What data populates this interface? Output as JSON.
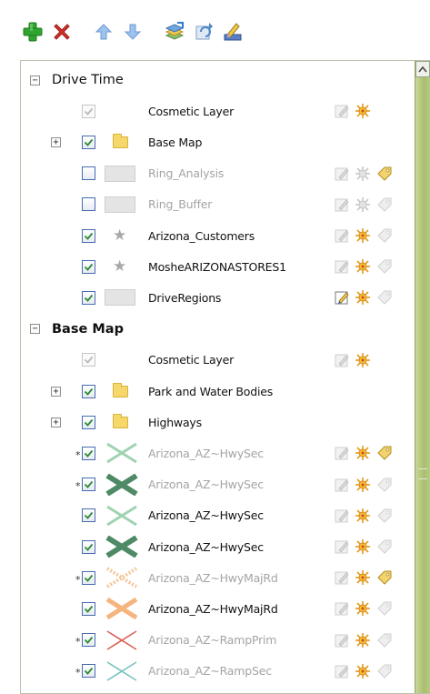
{
  "colors": {
    "checkmark": "#2d8a2d",
    "add_plus": "#2fa52f",
    "remove_x": "#d6322a",
    "arrow_blue": "#7ea9df",
    "scrollbar_green": "#a9be6e"
  },
  "toolbar": {
    "buttons": [
      {
        "icon": "plus-icon"
      },
      {
        "icon": "remove-x-icon"
      },
      {
        "icon": "arrow-up-icon"
      },
      {
        "icon": "arrow-down-icon"
      },
      {
        "icon": "layer-stack-icon"
      },
      {
        "icon": "refresh-icon"
      },
      {
        "icon": "pencil-edit-icon"
      }
    ]
  },
  "groups": [
    {
      "label": "Drive Time",
      "bold": false,
      "expander": "−",
      "layers": [
        {
          "label": "Cosmetic Layer",
          "checked": true,
          "grey_check": true,
          "symbol": "none",
          "dim": false,
          "tools": [
            "edit",
            "flag"
          ]
        },
        {
          "label": "Base Map",
          "checked": true,
          "expander": "+",
          "symbol": "folder",
          "dim": false,
          "tools": []
        },
        {
          "label": "Ring_Analysis",
          "checked": false,
          "symbol": "rect",
          "dim": true,
          "tools": [
            "edit",
            "flag-dim",
            "tag"
          ]
        },
        {
          "label": "Ring_Buffer",
          "checked": false,
          "symbol": "rect",
          "dim": true,
          "tools": [
            "edit",
            "flag-dim",
            "tag-dim"
          ]
        },
        {
          "label": "Arizona_Customers",
          "checked": true,
          "symbol": "star",
          "dim": false,
          "tools": [
            "edit",
            "flag",
            "tag-dim"
          ]
        },
        {
          "label": "MosheARIZONASTORES1",
          "checked": true,
          "symbol": "star",
          "dim": false,
          "tools": [
            "edit",
            "flag",
            "tag-dim"
          ]
        },
        {
          "label": "DriveRegions",
          "checked": true,
          "symbol": "rect",
          "dim": false,
          "tools": [
            "edit-active",
            "flag",
            "tag-dim"
          ]
        }
      ]
    },
    {
      "label": "Base Map",
      "bold": true,
      "expander": "−",
      "layers": [
        {
          "label": "Cosmetic Layer",
          "checked": true,
          "grey_check": true,
          "symbol": "none",
          "dim": false,
          "tools": [
            "edit",
            "flag"
          ]
        },
        {
          "label": "Park and Water Bodies",
          "checked": true,
          "expander": "+",
          "symbol": "folder",
          "dim": false,
          "tools": []
        },
        {
          "label": "Highways",
          "checked": true,
          "expander": "+",
          "symbol": "folder",
          "dim": false,
          "tools": []
        },
        {
          "label": "Arizona_AZ~HwySec",
          "checked": true,
          "asterisk": "*",
          "symbol": "x-light-green",
          "dim": true,
          "tools": [
            "edit",
            "flag",
            "tag"
          ]
        },
        {
          "label": "Arizona_AZ~HwySec",
          "checked": true,
          "asterisk": "*",
          "symbol": "x-dark-green",
          "dim": true,
          "tools": [
            "edit",
            "flag",
            "tag-dim"
          ]
        },
        {
          "label": "Arizona_AZ~HwySec",
          "checked": true,
          "symbol": "x-light-green",
          "dim": false,
          "tools": [
            "edit",
            "flag",
            "tag-dim"
          ]
        },
        {
          "label": "Arizona_AZ~HwySec",
          "checked": true,
          "symbol": "x-dark-green",
          "dim": false,
          "tools": [
            "edit",
            "flag",
            "tag-dim"
          ]
        },
        {
          "label": "Arizona_AZ~HwyMajRd",
          "checked": true,
          "asterisk": "*",
          "symbol": "x-orange-dashed",
          "dim": true,
          "tools": [
            "edit",
            "flag",
            "tag"
          ]
        },
        {
          "label": "Arizona_AZ~HwyMajRd",
          "checked": true,
          "symbol": "x-orange",
          "dim": false,
          "tools": [
            "edit",
            "flag",
            "tag-dim"
          ]
        },
        {
          "label": "Arizona_AZ~RampPrim",
          "checked": true,
          "asterisk": "*",
          "symbol": "x-red",
          "dim": true,
          "tools": [
            "edit",
            "flag",
            "tag-dim"
          ]
        },
        {
          "label": "Arizona_AZ~RampSec",
          "checked": true,
          "asterisk": "*",
          "symbol": "x-teal",
          "dim": true,
          "tools": [
            "edit",
            "flag",
            "tag-dim"
          ]
        }
      ]
    }
  ]
}
